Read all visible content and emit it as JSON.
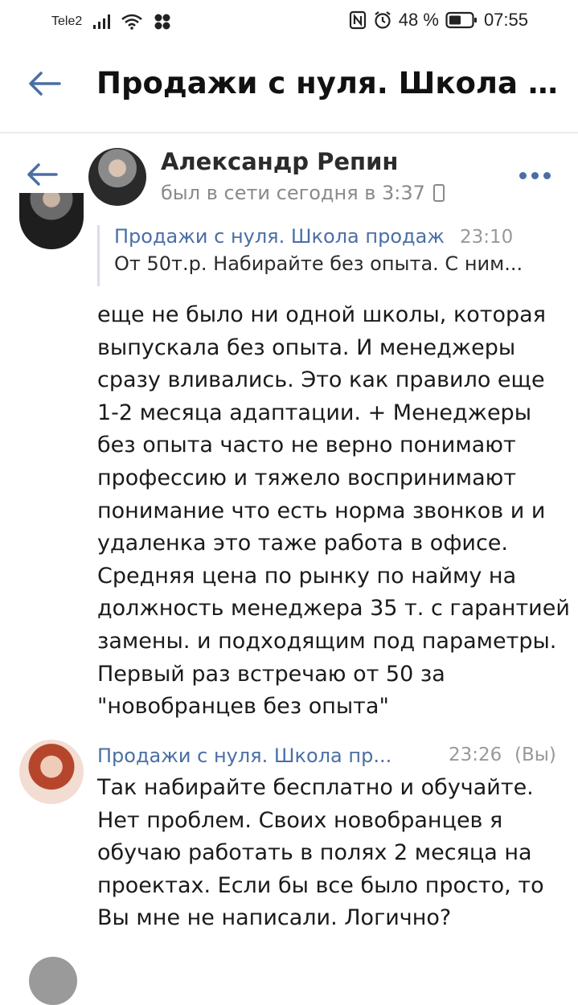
{
  "status_bar": {
    "carrier": "Tele2",
    "battery": "48 %",
    "time": "07:55"
  },
  "app_bar": {
    "title": "Продажи с нуля. Школа про..."
  },
  "chat_header": {
    "name": "Александр Репин",
    "status": "был в сети сегодня в 3:37"
  },
  "message_1": {
    "reply": {
      "author": "Продажи с нуля. Школа продаж",
      "time": "23:10",
      "text": "От 50т.р. Набирайте без опыта. С ним..."
    },
    "text": "еще не было ни одной школы, которая выпускала без опыта. И менеджеры сразу вливались. Это как правило еще 1-2 месяца адаптации. + Менеджеры без опыта часто не верно понимают профессию и тяжело воспринимают понимание что есть норма звонков и и удаленка это таже работа в офисе. Средняя цена по рынку по найму на должность менеджера 35 т. с гарантией замены. и подходящим под параметры. Первый раз встречаю от 50 за \"новобранцев без опыта\""
  },
  "message_2": {
    "author": "Продажи с нуля. Школа пр...",
    "time": "23:26",
    "you_label": "(Вы)",
    "text": "Так набирайте бесплатно и обучайте. Нет проблем. Своих новобранцев я обучаю работать в полях 2 месяца на проектах. Если бы все было просто, то Вы мне не написали. Логично?"
  },
  "colors": {
    "accent": "#4a6fa5",
    "muted": "#8a8a8a"
  }
}
